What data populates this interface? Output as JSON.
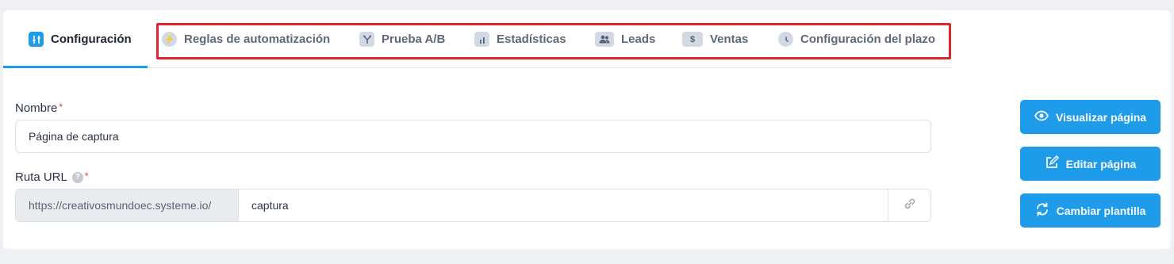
{
  "tabs": [
    {
      "label": "Configuración",
      "icon": "sliders-icon",
      "active": true
    },
    {
      "label": "Reglas de automatización",
      "icon": "lightning-icon"
    },
    {
      "label": "Prueba A/B",
      "icon": "split-icon"
    },
    {
      "label": "Estadísticas",
      "icon": "bar-chart-icon"
    },
    {
      "label": "Leads",
      "icon": "users-icon"
    },
    {
      "label": "Ventas",
      "icon": "dollar-icon"
    },
    {
      "label": "Configuración del plazo",
      "icon": "clock-icon"
    }
  ],
  "form": {
    "name_label": "Nombre",
    "name_value": "Página de captura",
    "url_label": "Ruta URL",
    "url_prefix": "https://creativosmundoec.systeme.io/",
    "url_path": "captura",
    "required_mark": "*",
    "help_mark": "?"
  },
  "actions": {
    "preview": "Visualizar página",
    "edit": "Editar página",
    "change_template": "Cambiar plantilla"
  },
  "colors": {
    "accent": "#1e9be9",
    "highlight": "#e0242b",
    "required": "#e53935"
  }
}
